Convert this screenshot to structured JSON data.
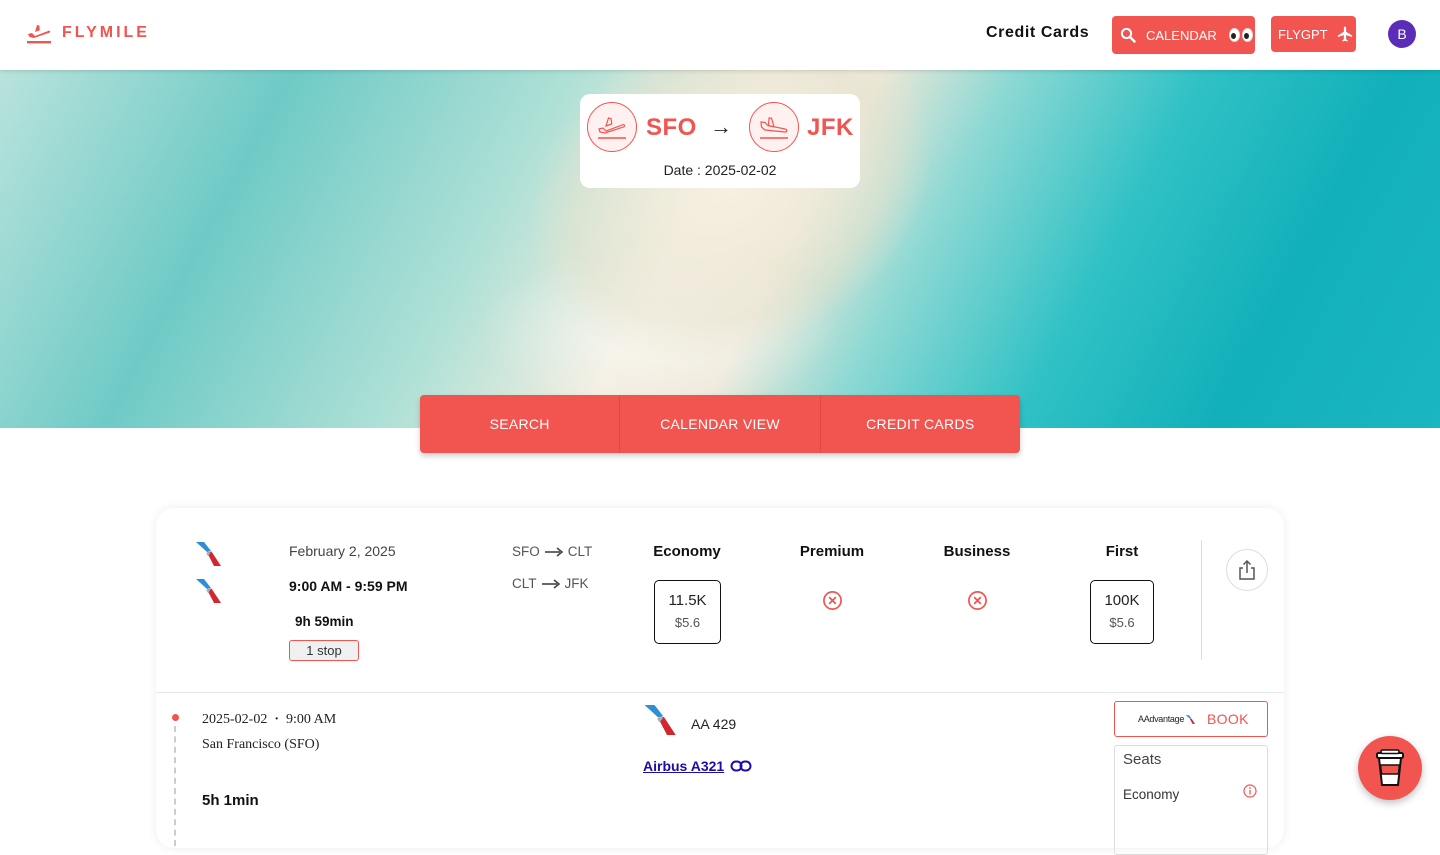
{
  "navbar": {
    "brand": "FLYMILE",
    "credit_cards": "Credit Cards",
    "calendar_button": "CALENDAR",
    "flygpt_button": "FLYGPT",
    "avatar_initial": "B"
  },
  "route": {
    "origin": "SFO",
    "destination": "JFK",
    "arrow": "→",
    "date": "Date : 2025-02-02"
  },
  "tabs": [
    "SEARCH",
    "CALENDAR VIEW",
    "CREDIT CARDS"
  ],
  "flight": {
    "date": "February 2, 2025",
    "time": "9:00 AM - 9:59 PM",
    "duration": "9h 59min",
    "stops": "1 stop",
    "segments": [
      {
        "from": "SFO",
        "to": "CLT"
      },
      {
        "from": "CLT",
        "to": "JFK"
      }
    ],
    "cabins": {
      "economy": {
        "label": "Economy",
        "miles": "11.5K",
        "tax": "$5.6"
      },
      "premium": {
        "label": "Premium"
      },
      "business": {
        "label": "Business"
      },
      "first": {
        "label": "First",
        "miles": "100K",
        "tax": "$5.6"
      }
    },
    "leg": {
      "date": "2025-02-02",
      "time": "9:00 AM",
      "city": "San Francisco (SFO)",
      "duration": "5h 1min",
      "flight_number": "AA 429",
      "aircraft": "Airbus A321",
      "book_brand": "AAdvantage",
      "book_label": "BOOK",
      "seats_title": "Seats",
      "seats_economy": "Economy"
    }
  },
  "colors": {
    "accent": "#f25450",
    "avatar": "#5b2cb8",
    "link": "#1a0dab"
  }
}
